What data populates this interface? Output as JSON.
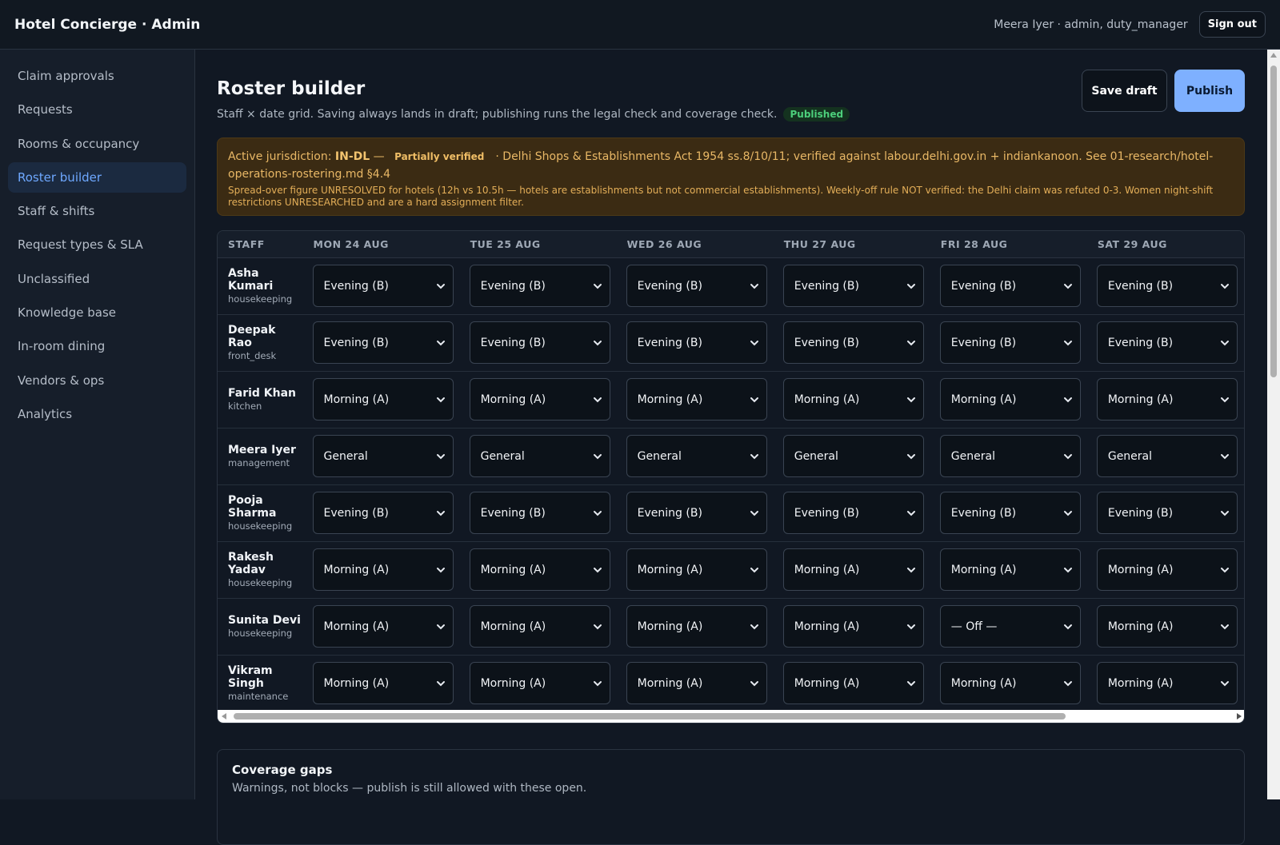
{
  "app": {
    "title": "Hotel Concierge · Admin",
    "user": "Meera Iyer · admin, duty_manager",
    "signout_label": "Sign out"
  },
  "sidebar": {
    "items": [
      {
        "label": "Claim approvals",
        "active": false
      },
      {
        "label": "Requests",
        "active": false
      },
      {
        "label": "Rooms & occupancy",
        "active": false
      },
      {
        "label": "Roster builder",
        "active": true
      },
      {
        "label": "Staff & shifts",
        "active": false
      },
      {
        "label": "Request types & SLA",
        "active": false
      },
      {
        "label": "Unclassified",
        "active": false
      },
      {
        "label": "Knowledge base",
        "active": false
      },
      {
        "label": "In-room dining",
        "active": false
      },
      {
        "label": "Vendors & ops",
        "active": false
      },
      {
        "label": "Analytics",
        "active": false
      }
    ]
  },
  "page": {
    "title": "Roster builder",
    "subtitle": "Staff × date grid. Saving always lands in draft; publishing runs the legal check and coverage check.",
    "status_badge": "Published",
    "save_draft_label": "Save draft",
    "publish_label": "Publish"
  },
  "jurisdiction": {
    "prefix": "Active jurisdiction:",
    "code": "IN-DL",
    "dash": "—",
    "badge": "Partially verified",
    "text": "· Delhi Shops & Establishments Act 1954 ss.8/10/11; verified against labour.delhi.gov.in + indiankanoon. See 01-research/hotel-operations-rostering.md §4.4",
    "note": "Spread-over figure UNRESOLVED for hotels (12h vs 10.5h — hotels are establishments but not commercial establishments). Weekly-off rule NOT verified: the Delhi claim was refuted 0-3. Women night-shift restrictions UNRESEARCHED and are a hard assignment filter."
  },
  "roster": {
    "staff_header": "STAFF",
    "days": [
      "MON 24 AUG",
      "TUE 25 AUG",
      "WED 26 AUG",
      "THU 27 AUG",
      "FRI 28 AUG",
      "SAT 29 AUG"
    ],
    "rows": [
      {
        "name": "Asha Kumari",
        "role": "housekeeping",
        "shifts": [
          "Evening (B)",
          "Evening (B)",
          "Evening (B)",
          "Evening (B)",
          "Evening (B)",
          "Evening (B)"
        ]
      },
      {
        "name": "Deepak Rao",
        "role": "front_desk",
        "shifts": [
          "Evening (B)",
          "Evening (B)",
          "Evening (B)",
          "Evening (B)",
          "Evening (B)",
          "Evening (B)"
        ]
      },
      {
        "name": "Farid Khan",
        "role": "kitchen",
        "shifts": [
          "Morning (A)",
          "Morning (A)",
          "Morning (A)",
          "Morning (A)",
          "Morning (A)",
          "Morning (A)"
        ]
      },
      {
        "name": "Meera Iyer",
        "role": "management",
        "shifts": [
          "General",
          "General",
          "General",
          "General",
          "General",
          "General"
        ]
      },
      {
        "name": "Pooja Sharma",
        "role": "housekeeping",
        "shifts": [
          "Evening (B)",
          "Evening (B)",
          "Evening (B)",
          "Evening (B)",
          "Evening (B)",
          "Evening (B)"
        ]
      },
      {
        "name": "Rakesh Yadav",
        "role": "housekeeping",
        "shifts": [
          "Morning (A)",
          "Morning (A)",
          "Morning (A)",
          "Morning (A)",
          "Morning (A)",
          "Morning (A)"
        ]
      },
      {
        "name": "Sunita Devi",
        "role": "housekeeping",
        "shifts": [
          "Morning (A)",
          "Morning (A)",
          "Morning (A)",
          "Morning (A)",
          "— Off —",
          "Morning (A)"
        ]
      },
      {
        "name": "Vikram Singh",
        "role": "maintenance",
        "shifts": [
          "Morning (A)",
          "Morning (A)",
          "Morning (A)",
          "Morning (A)",
          "Morning (A)",
          "Morning (A)"
        ]
      }
    ]
  },
  "coverage": {
    "title": "Coverage gaps",
    "subtitle": "Warnings, not blocks — publish is still allowed with these open."
  }
}
